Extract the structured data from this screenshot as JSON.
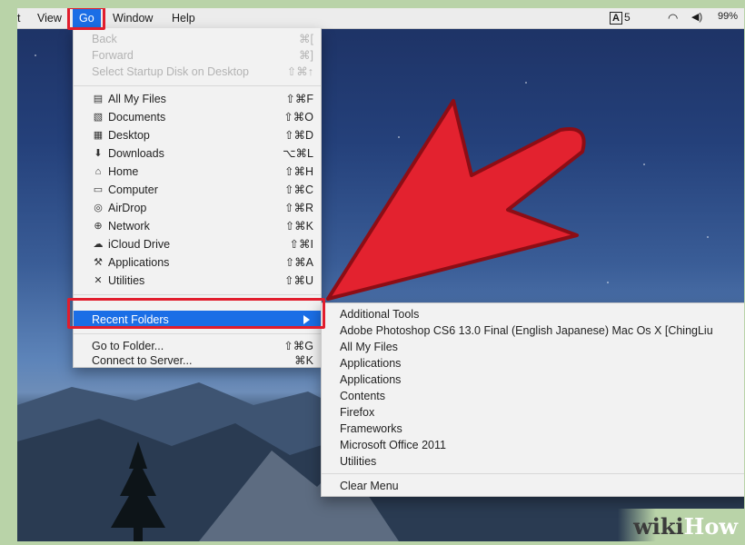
{
  "menubar": {
    "partial_item": "t",
    "items": [
      "View",
      "Go",
      "Window",
      "Help"
    ],
    "status": {
      "input_label": "A",
      "input_num": "5",
      "battery": "99%"
    }
  },
  "go_menu": {
    "items": [
      {
        "label": "Back",
        "shortcut": "⌘[",
        "disabled": true
      },
      {
        "label": "Forward",
        "shortcut": "⌘]",
        "disabled": true
      },
      {
        "label": "Select Startup Disk on Desktop",
        "shortcut": "⇧⌘↑",
        "disabled": true
      },
      {
        "label": "All My Files",
        "shortcut": "⇧⌘F",
        "icon": "all-files-icon"
      },
      {
        "label": "Documents",
        "shortcut": "⇧⌘O",
        "icon": "documents-icon"
      },
      {
        "label": "Desktop",
        "shortcut": "⇧⌘D",
        "icon": "desktop-icon"
      },
      {
        "label": "Downloads",
        "shortcut": "⌥⌘L",
        "icon": "downloads-icon"
      },
      {
        "label": "Home",
        "shortcut": "⇧⌘H",
        "icon": "home-icon"
      },
      {
        "label": "Computer",
        "shortcut": "⇧⌘C",
        "icon": "computer-icon"
      },
      {
        "label": "AirDrop",
        "shortcut": "⇧⌘R",
        "icon": "airdrop-icon"
      },
      {
        "label": "Network",
        "shortcut": "⇧⌘K",
        "icon": "network-icon"
      },
      {
        "label": "iCloud Drive",
        "shortcut": "⇧⌘I",
        "icon": "icloud-icon"
      },
      {
        "label": "Applications",
        "shortcut": "⇧⌘A",
        "icon": "applications-icon"
      },
      {
        "label": "Utilities",
        "shortcut": "⇧⌘U",
        "icon": "utilities-icon"
      },
      {
        "label": "Recent Folders",
        "selected": true
      },
      {
        "label": "Go to Folder...",
        "shortcut": "⇧⌘G"
      },
      {
        "label": "Connect to Server...",
        "shortcut": "⌘K"
      }
    ]
  },
  "recent_folders": {
    "items": [
      "Additional Tools",
      "Adobe Photoshop CS6 13.0 Final (English Japanese)  Mac Os X [ChingLiu",
      "All My Files",
      "Applications",
      "Applications",
      "Contents",
      "Firefox",
      "Frameworks",
      "Microsoft Office 2011",
      "Utilities"
    ],
    "clear": "Clear Menu"
  },
  "watermark": {
    "part1": "wiki",
    "part2": "How"
  },
  "colors": {
    "highlight": "#1b6ee6",
    "annotation_red": "#e11d2d"
  }
}
